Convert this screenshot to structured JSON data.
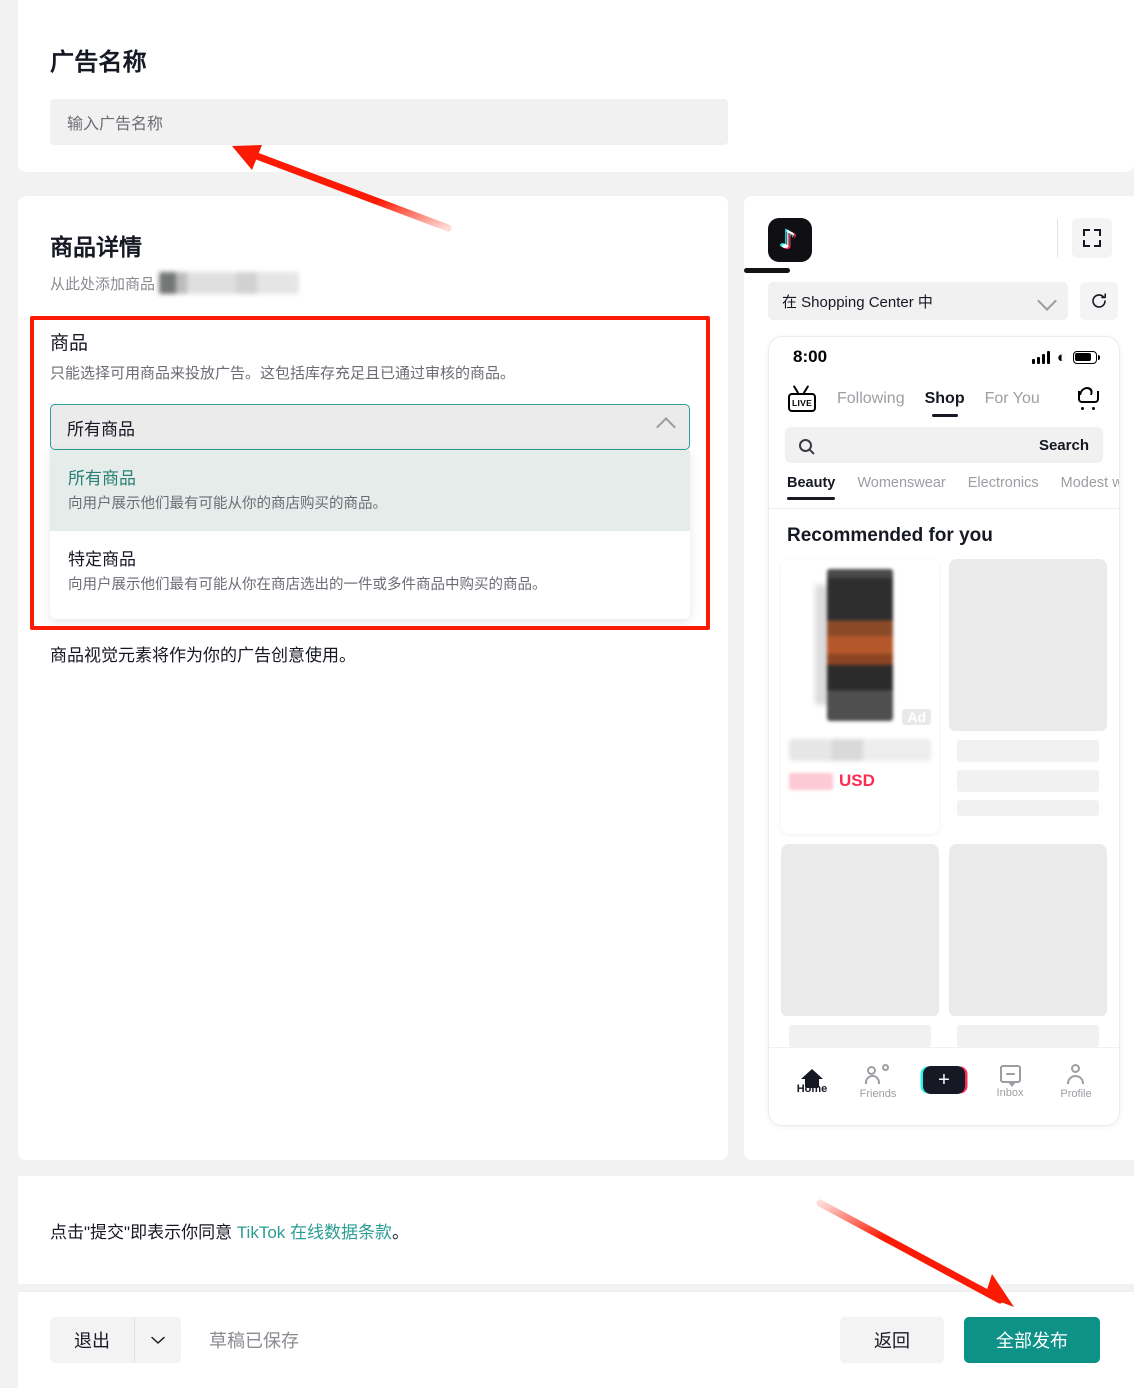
{
  "ad_name": {
    "heading": "广告名称",
    "placeholder": "输入广告名称",
    "value": ""
  },
  "product_details": {
    "heading": "商品详情",
    "subtitle": "从此处添加商品",
    "product_label": "商品",
    "product_desc": "只能选择可用商品来投放广告。这包括库存充足且已通过审核的商品。",
    "select_value": "所有商品",
    "options": [
      {
        "label": "所有商品",
        "desc": "向用户展示他们最有可能从你的商店购买的商品。",
        "selected": true
      },
      {
        "label": "特定商品",
        "desc": "向用户展示他们最有可能从你在商店选出的一件或多件商品中购买的商品。",
        "selected": false
      }
    ],
    "after_note": "商品视觉元素将作为你的广告创意使用。"
  },
  "preview": {
    "placement_value": "在 Shopping Center 中",
    "phone": {
      "status_time": "8:00",
      "live_label": "LIVE",
      "top_tabs": [
        {
          "label": "Following",
          "active": false
        },
        {
          "label": "Shop",
          "active": true
        },
        {
          "label": "For You",
          "active": false
        }
      ],
      "search_label": "Search",
      "categories": [
        {
          "label": "Beauty",
          "active": true
        },
        {
          "label": "Womenswear",
          "active": false
        },
        {
          "label": "Electronics",
          "active": false
        },
        {
          "label": "Modest wear",
          "active": false
        }
      ],
      "recommended_title": "Recommended for you",
      "ad_badge": "Ad",
      "currency": "USD",
      "nav": [
        {
          "label": "Home",
          "icon": "home-icon",
          "active": true
        },
        {
          "label": "Friends",
          "icon": "friends-icon",
          "active": false
        },
        {
          "label": "",
          "icon": "create-plus-icon",
          "active": false
        },
        {
          "label": "Inbox",
          "icon": "inbox-icon",
          "active": false
        },
        {
          "label": "Profile",
          "icon": "profile-icon",
          "active": false
        }
      ]
    }
  },
  "disclaimer": {
    "prefix": "点击\"提交\"即表示你同意 ",
    "link": "TikTok 在线数据条款",
    "suffix": "。"
  },
  "footer": {
    "exit_label": "退出",
    "draft_status": "草稿已保存",
    "back_label": "返回",
    "publish_label": "全部发布"
  },
  "colors": {
    "accent_teal": "#0e9288",
    "select_border": "#2a9d94",
    "highlight_red": "#fb1b04",
    "price_pink": "#fe2c55"
  }
}
